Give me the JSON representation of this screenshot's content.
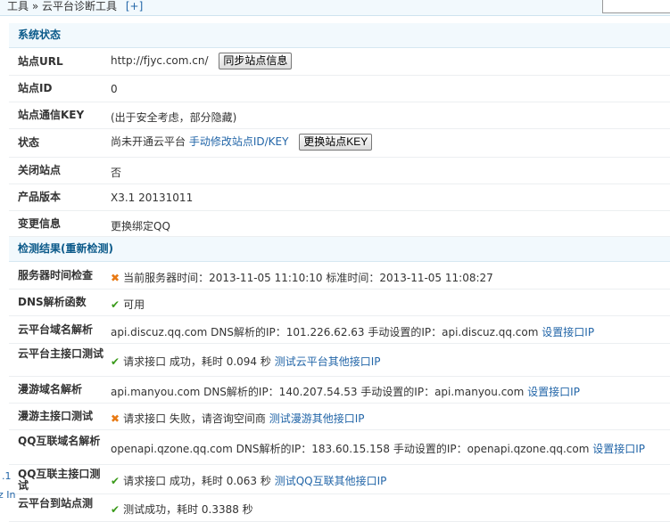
{
  "breadcrumb": {
    "root": "工具",
    "sep": "»",
    "current": "云平台诊断工具",
    "plus": "[+]"
  },
  "sections": {
    "system_status": "系统状态",
    "check_results": "检测结果(重新检测)"
  },
  "status": {
    "site_url": {
      "label": "站点URL",
      "value": "http://fjyc.com.cn/",
      "button": "同步站点信息"
    },
    "site_id": {
      "label": "站点ID",
      "value": "0"
    },
    "site_key": {
      "label": "站点通信KEY",
      "value": "(出于安全考虑，部分隐藏)"
    },
    "state": {
      "label": "状态",
      "value": "尚未开通云平台",
      "link": "手动修改站点ID/KEY",
      "button": "更换站点KEY"
    },
    "closed": {
      "label": "关闭站点",
      "value": "否"
    },
    "version": {
      "label": "产品版本",
      "value": "X3.1 20131011"
    },
    "change_info": {
      "label": "变更信息",
      "link": "更换绑定QQ"
    }
  },
  "checks": {
    "server_time": {
      "label": "服务器时间检查",
      "status": "fail",
      "text": "当前服务器时间：2013-11-05 11:10:10 标准时间：2013-11-05 11:08:27"
    },
    "dns_func": {
      "label": "DNS解析函数",
      "status": "ok",
      "text": "可用"
    },
    "cloud_dns": {
      "label": "云平台域名解析",
      "text": "api.discuz.qq.com DNS解析的IP：101.226.62.63 手动设置的IP：api.discuz.qq.com",
      "link": "设置接口IP"
    },
    "cloud_api": {
      "label": "云平台主接口测试",
      "status": "ok",
      "text": "请求接口 成功，耗时 0.094 秒",
      "link": "测试云平台其他接口IP"
    },
    "manyou_dns": {
      "label": "漫游域名解析",
      "text": "api.manyou.com DNS解析的IP：140.207.54.53 手动设置的IP：api.manyou.com",
      "link": "设置接口IP"
    },
    "manyou_api": {
      "label": "漫游主接口测试",
      "status": "fail",
      "text": "请求接口 失败，请咨询空间商",
      "link": "测试漫游其他接口IP"
    },
    "qq_dns": {
      "label": "QQ互联域名解析",
      "text": "openapi.qzone.qq.com DNS解析的IP：183.60.15.158 手动设置的IP：openapi.qzone.qq.com",
      "link": "设置接口IP"
    },
    "qq_api": {
      "label": "QQ互联主接口测试",
      "status": "ok",
      "text": "请求接口 成功，耗时 0.063 秒",
      "link": "测试QQ互联其他接口IP"
    },
    "cloud_to_site": {
      "label": "云平台到站点测",
      "status": "ok",
      "text": "测试成功，耗时 0.3388 秒"
    }
  },
  "overlay": {
    "line1": ".1",
    "line2": "z In"
  }
}
